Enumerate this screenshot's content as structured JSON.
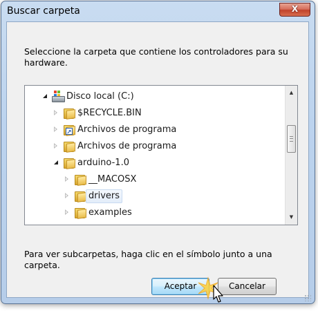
{
  "window": {
    "title": "Buscar carpeta",
    "close_label": "X"
  },
  "instructions": "Seleccione la carpeta que contiene los controladores para su hardware.",
  "tree": {
    "items": [
      {
        "label": "Disco local (C:)",
        "icon": "drive-icon",
        "expander": "expanded"
      },
      {
        "label": "$RECYCLE.BIN",
        "icon": "folder-icon",
        "expander": "collapsed"
      },
      {
        "label": "Archivos de programa",
        "icon": "folder-shortcut-icon",
        "expander": "collapsed"
      },
      {
        "label": "Archivos de programa",
        "icon": "folder-icon",
        "expander": "collapsed"
      },
      {
        "label": "arduino-1.0",
        "icon": "folder-icon",
        "expander": "expanded"
      },
      {
        "label": "__MACOSX",
        "icon": "folder-icon",
        "expander": "collapsed"
      },
      {
        "label": "drivers",
        "icon": "folder-icon",
        "expander": "collapsed",
        "state": "hover"
      },
      {
        "label": "examples",
        "icon": "folder-icon",
        "expander": "collapsed"
      }
    ]
  },
  "hint": "Para ver subcarpetas, haga clic en el símbolo junto a una carpeta.",
  "buttons": {
    "accept": "Aceptar",
    "cancel": "Cancelar"
  },
  "colors": {
    "title_bar": "#c9dcf1",
    "close_button": "#c1432b",
    "default_button": "#3c7fb1"
  }
}
